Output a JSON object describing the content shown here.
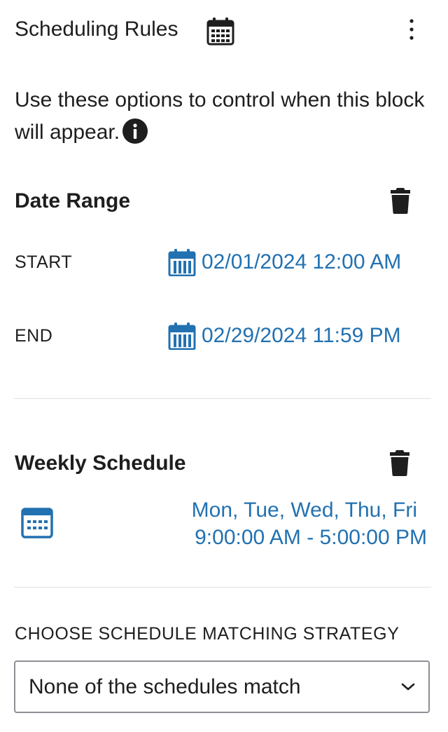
{
  "panel": {
    "title": "Scheduling Rules",
    "title_icon": "calendar-icon",
    "menu_icon": "vertical-ellipsis-icon",
    "description": "Use these options to control when this block will appear.",
    "info_icon": "info-icon"
  },
  "date_range": {
    "title": "Date Range",
    "delete_icon": "trash-icon",
    "start_label": "START",
    "start_value": "02/01/2024 12:00 AM",
    "end_label": "END",
    "end_value": "02/29/2024 11:59 PM",
    "date_icon": "calendar-icon"
  },
  "weekly_schedule": {
    "title": "Weekly Schedule",
    "delete_icon": "trash-icon",
    "calendar_icon": "calendar-icon",
    "days": "Mon, Tue, Wed, Thu, Fri",
    "time_range": "9:00:00 AM - 5:00:00 PM"
  },
  "strategy": {
    "label": "CHOOSE SCHEDULE MATCHING STRATEGY",
    "selected": "None of the schedules match",
    "chevron_icon": "chevron-down-icon"
  },
  "colors": {
    "text": "#1e1e1e",
    "accent": "#2271b1",
    "divider": "#e0e0e0",
    "select_border": "#8c8f94"
  }
}
